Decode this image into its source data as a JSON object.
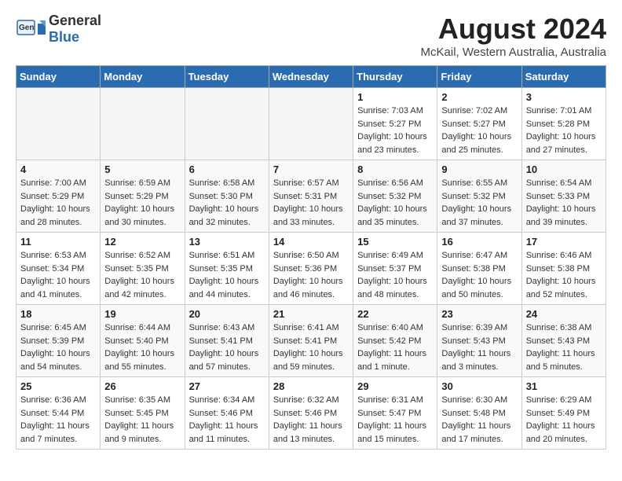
{
  "header": {
    "logo_general": "General",
    "logo_blue": "Blue",
    "month_title": "August 2024",
    "location": "McKail, Western Australia, Australia"
  },
  "days_of_week": [
    "Sunday",
    "Monday",
    "Tuesday",
    "Wednesday",
    "Thursday",
    "Friday",
    "Saturday"
  ],
  "weeks": [
    [
      {
        "day": "",
        "empty": true
      },
      {
        "day": "",
        "empty": true
      },
      {
        "day": "",
        "empty": true
      },
      {
        "day": "",
        "empty": true
      },
      {
        "day": "1",
        "sunrise": "7:03 AM",
        "sunset": "5:27 PM",
        "daylight": "10 hours and 23 minutes."
      },
      {
        "day": "2",
        "sunrise": "7:02 AM",
        "sunset": "5:27 PM",
        "daylight": "10 hours and 25 minutes."
      },
      {
        "day": "3",
        "sunrise": "7:01 AM",
        "sunset": "5:28 PM",
        "daylight": "10 hours and 27 minutes."
      }
    ],
    [
      {
        "day": "4",
        "sunrise": "7:00 AM",
        "sunset": "5:29 PM",
        "daylight": "10 hours and 28 minutes."
      },
      {
        "day": "5",
        "sunrise": "6:59 AM",
        "sunset": "5:29 PM",
        "daylight": "10 hours and 30 minutes."
      },
      {
        "day": "6",
        "sunrise": "6:58 AM",
        "sunset": "5:30 PM",
        "daylight": "10 hours and 32 minutes."
      },
      {
        "day": "7",
        "sunrise": "6:57 AM",
        "sunset": "5:31 PM",
        "daylight": "10 hours and 33 minutes."
      },
      {
        "day": "8",
        "sunrise": "6:56 AM",
        "sunset": "5:32 PM",
        "daylight": "10 hours and 35 minutes."
      },
      {
        "day": "9",
        "sunrise": "6:55 AM",
        "sunset": "5:32 PM",
        "daylight": "10 hours and 37 minutes."
      },
      {
        "day": "10",
        "sunrise": "6:54 AM",
        "sunset": "5:33 PM",
        "daylight": "10 hours and 39 minutes."
      }
    ],
    [
      {
        "day": "11",
        "sunrise": "6:53 AM",
        "sunset": "5:34 PM",
        "daylight": "10 hours and 41 minutes."
      },
      {
        "day": "12",
        "sunrise": "6:52 AM",
        "sunset": "5:35 PM",
        "daylight": "10 hours and 42 minutes."
      },
      {
        "day": "13",
        "sunrise": "6:51 AM",
        "sunset": "5:35 PM",
        "daylight": "10 hours and 44 minutes."
      },
      {
        "day": "14",
        "sunrise": "6:50 AM",
        "sunset": "5:36 PM",
        "daylight": "10 hours and 46 minutes."
      },
      {
        "day": "15",
        "sunrise": "6:49 AM",
        "sunset": "5:37 PM",
        "daylight": "10 hours and 48 minutes."
      },
      {
        "day": "16",
        "sunrise": "6:47 AM",
        "sunset": "5:38 PM",
        "daylight": "10 hours and 50 minutes."
      },
      {
        "day": "17",
        "sunrise": "6:46 AM",
        "sunset": "5:38 PM",
        "daylight": "10 hours and 52 minutes."
      }
    ],
    [
      {
        "day": "18",
        "sunrise": "6:45 AM",
        "sunset": "5:39 PM",
        "daylight": "10 hours and 54 minutes."
      },
      {
        "day": "19",
        "sunrise": "6:44 AM",
        "sunset": "5:40 PM",
        "daylight": "10 hours and 55 minutes."
      },
      {
        "day": "20",
        "sunrise": "6:43 AM",
        "sunset": "5:41 PM",
        "daylight": "10 hours and 57 minutes."
      },
      {
        "day": "21",
        "sunrise": "6:41 AM",
        "sunset": "5:41 PM",
        "daylight": "10 hours and 59 minutes."
      },
      {
        "day": "22",
        "sunrise": "6:40 AM",
        "sunset": "5:42 PM",
        "daylight": "11 hours and 1 minute."
      },
      {
        "day": "23",
        "sunrise": "6:39 AM",
        "sunset": "5:43 PM",
        "daylight": "11 hours and 3 minutes."
      },
      {
        "day": "24",
        "sunrise": "6:38 AM",
        "sunset": "5:43 PM",
        "daylight": "11 hours and 5 minutes."
      }
    ],
    [
      {
        "day": "25",
        "sunrise": "6:36 AM",
        "sunset": "5:44 PM",
        "daylight": "11 hours and 7 minutes."
      },
      {
        "day": "26",
        "sunrise": "6:35 AM",
        "sunset": "5:45 PM",
        "daylight": "11 hours and 9 minutes."
      },
      {
        "day": "27",
        "sunrise": "6:34 AM",
        "sunset": "5:46 PM",
        "daylight": "11 hours and 11 minutes."
      },
      {
        "day": "28",
        "sunrise": "6:32 AM",
        "sunset": "5:46 PM",
        "daylight": "11 hours and 13 minutes."
      },
      {
        "day": "29",
        "sunrise": "6:31 AM",
        "sunset": "5:47 PM",
        "daylight": "11 hours and 15 minutes."
      },
      {
        "day": "30",
        "sunrise": "6:30 AM",
        "sunset": "5:48 PM",
        "daylight": "11 hours and 17 minutes."
      },
      {
        "day": "31",
        "sunrise": "6:29 AM",
        "sunset": "5:49 PM",
        "daylight": "11 hours and 20 minutes."
      }
    ]
  ],
  "labels": {
    "sunrise_label": "Sunrise:",
    "sunset_label": "Sunset:",
    "daylight_label": "Daylight:"
  }
}
